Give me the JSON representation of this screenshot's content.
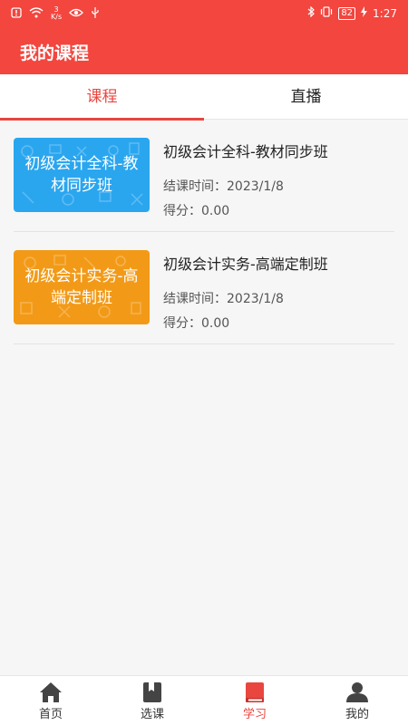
{
  "status_bar": {
    "net_speed_top": "3",
    "net_speed_unit": "K/s",
    "battery": "82",
    "time": "1:27"
  },
  "header": {
    "title": "我的课程"
  },
  "tabs": [
    {
      "label": "课程",
      "active": true
    },
    {
      "label": "直播",
      "active": false
    }
  ],
  "courses": [
    {
      "thumb_text": "初级会计全科-教材同步班",
      "thumb_color": "#2aa6ef",
      "title": "初级会计全科-教材同步班",
      "date_label": "结课时间：",
      "date": "2023/1/8",
      "score_label": "得分：",
      "score": "0.00"
    },
    {
      "thumb_text": "初级会计实务-高端定制班",
      "thumb_color": "#f29a17",
      "title": "初级会计实务-高端定制班",
      "date_label": "结课时间：",
      "date": "2023/1/8",
      "score_label": "得分：",
      "score": "0.00"
    }
  ],
  "bottom_nav": [
    {
      "label": "首页",
      "icon": "home-icon",
      "active": false
    },
    {
      "label": "选课",
      "icon": "bookmark-icon",
      "active": false
    },
    {
      "label": "学习",
      "icon": "book-icon",
      "active": true
    },
    {
      "label": "我的",
      "icon": "user-icon",
      "active": false
    }
  ],
  "colors": {
    "brand_red": "#f2463f",
    "active_text": "#e8463f"
  }
}
